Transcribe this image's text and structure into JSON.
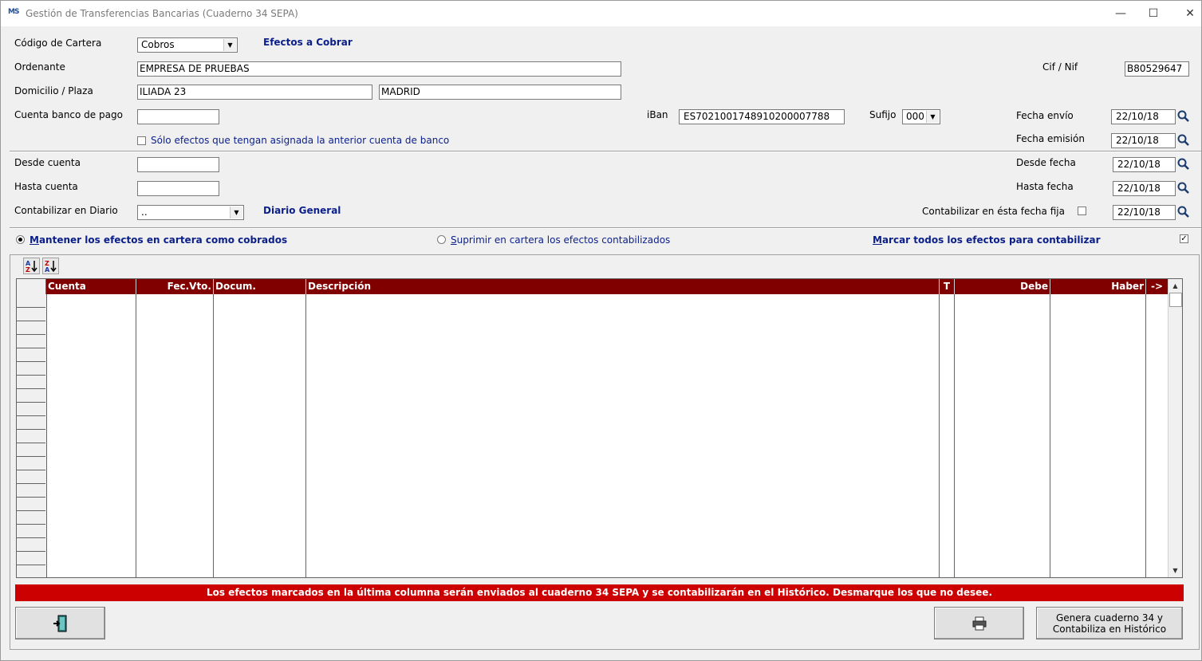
{
  "window": {
    "title": "Gestión de Transferencias Bancarias (Cuaderno 34 SEPA)",
    "icon_text": "MS"
  },
  "form": {
    "codigo_cartera_label": "Código de Cartera",
    "codigo_cartera_value": "Cobros",
    "codigo_cartera_desc": "Efectos a Cobrar",
    "ordenante_label": "Ordenante",
    "ordenante_value": "EMPRESA DE PRUEBAS",
    "cif_label": "Cif / Nif",
    "cif_value": "B80529647",
    "domicilio_label": "Domicilio / Plaza",
    "domicilio_value": "ILIADA 23",
    "plaza_value": "MADRID",
    "cuenta_banco_label": "Cuenta banco de pago",
    "cuenta_banco_value": "",
    "iban_label": "iBan",
    "iban_value": "ES7021001748910200007788",
    "sufijo_label": "Sufijo",
    "sufijo_value": "000",
    "fecha_envio_label": "Fecha envío",
    "fecha_envio_value": "22/10/18",
    "solo_efectos_label": "Sólo efectos que tengan asignada la anterior cuenta de banco",
    "fecha_emision_label": "Fecha emisión",
    "fecha_emision_value": "22/10/18",
    "desde_cuenta_label": "Desde cuenta",
    "desde_cuenta_value": "",
    "desde_fecha_label": "Desde fecha",
    "desde_fecha_value": "22/10/18",
    "hasta_cuenta_label": "Hasta cuenta",
    "hasta_cuenta_value": "",
    "hasta_fecha_label": "Hasta fecha",
    "hasta_fecha_value": "22/10/18",
    "diario_label": "Contabilizar en Diario",
    "diario_value": "..",
    "diario_desc": "Diario General",
    "fecha_fija_label": "Contabilizar en ésta fecha fija",
    "fecha_fija_value": "22/10/18"
  },
  "options": {
    "mantener_underline": "M",
    "mantener_rest": "antener los efectos en cartera como cobrados",
    "suprimir_underline": "S",
    "suprimir_rest": "uprimir en cartera los efectos contabilizados",
    "marcar_underline": "M",
    "marcar_rest": "arcar todos los efectos para contabilizar",
    "mantener_selected": true,
    "marcar_checked": true
  },
  "grid": {
    "headers": [
      "Cuenta",
      "Fec.Vto.",
      "Docum.",
      "Descripción",
      "T",
      "Debe",
      "Haber",
      "->"
    ]
  },
  "message": "Los efectos marcados en la última columna serán enviados al cuaderno 34 SEPA y se contabilizarán en el Histórico. Desmarque los que no desee.",
  "buttons": {
    "genera_line1": "Genera cuaderno 34 y",
    "genera_line2": "Contabiliza en Histórico"
  },
  "colors": {
    "grid_header_bg": "#800000",
    "message_bg": "#cc0000",
    "link_blue": "#0b1f8a"
  }
}
